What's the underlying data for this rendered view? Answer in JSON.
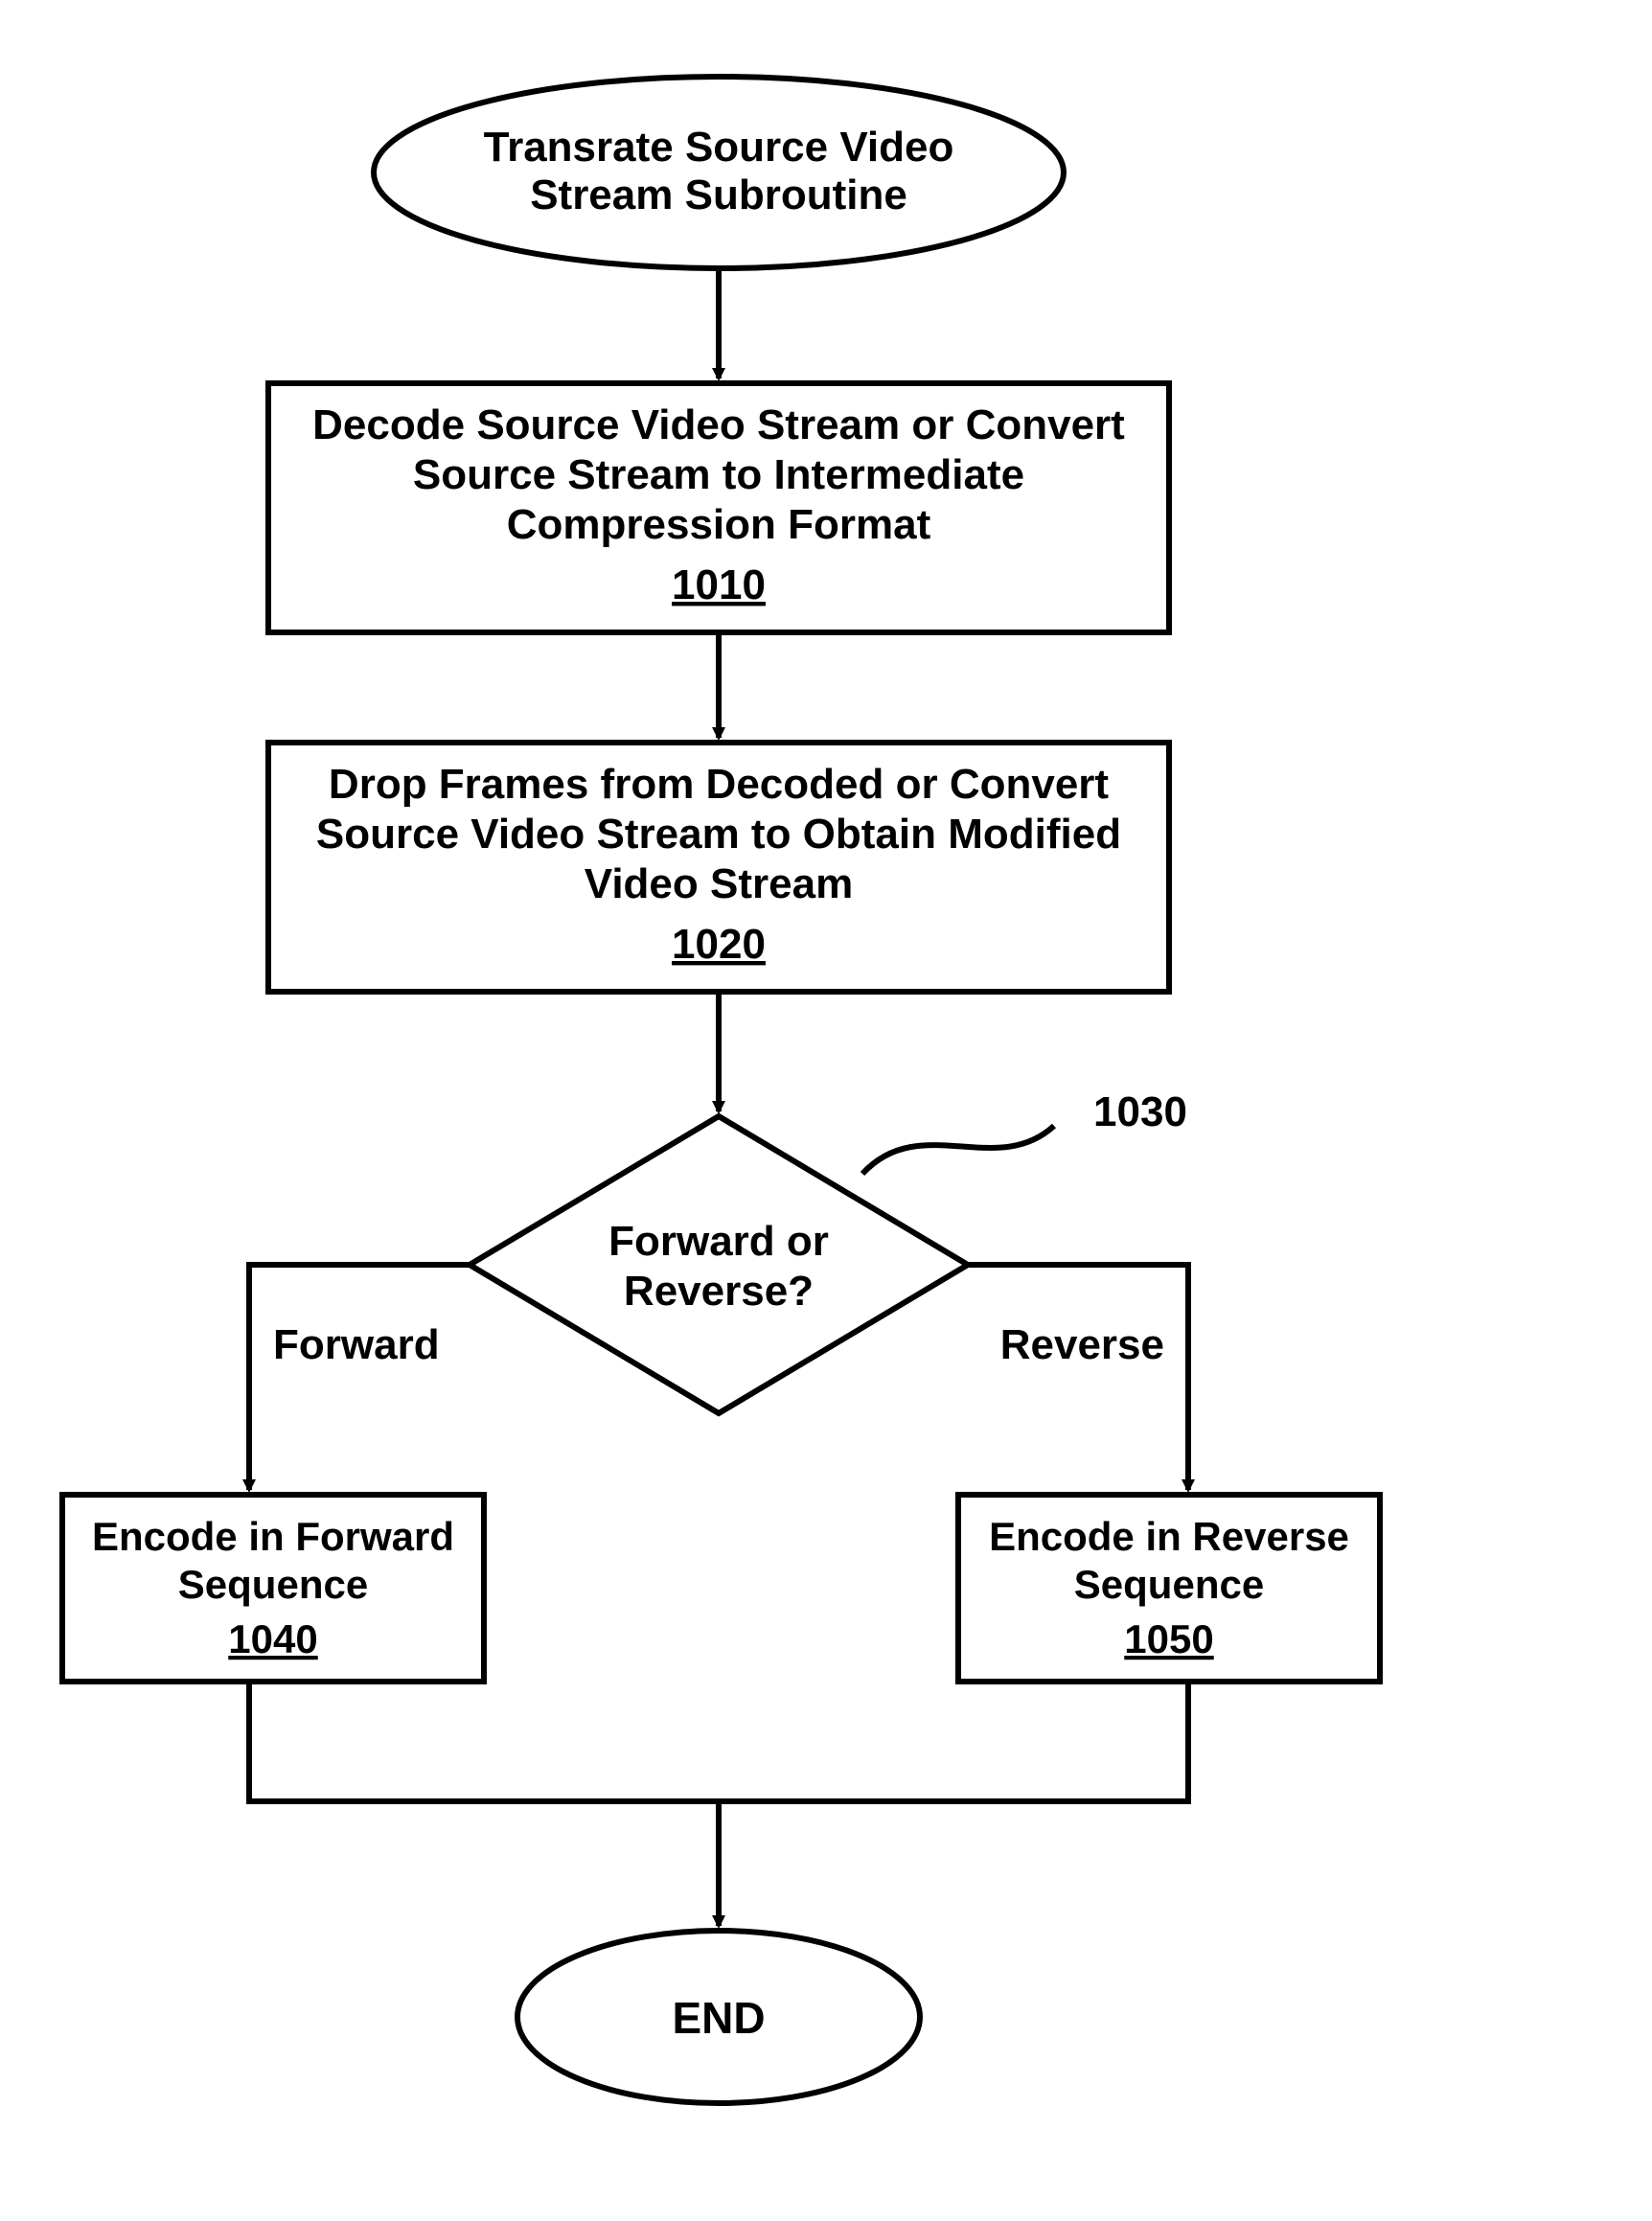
{
  "chart_data": {
    "type": "flowchart",
    "nodes": [
      {
        "id": "start",
        "shape": "terminator",
        "text_lines": [
          "Transrate Source  Video",
          "Stream Subroutine"
        ]
      },
      {
        "id": "n1010",
        "shape": "process",
        "ref": "1010",
        "text_lines": [
          "Decode Source Video Stream or Convert",
          "Source Stream to Intermediate",
          "Compression Format"
        ]
      },
      {
        "id": "n1020",
        "shape": "process",
        "ref": "1020",
        "text_lines": [
          "Drop Frames from Decoded or Convert",
          "Source Video Stream to Obtain Modified",
          "Video Stream"
        ]
      },
      {
        "id": "n1030",
        "shape": "decision",
        "ref": "1030",
        "text_lines": [
          "Forward or",
          "Reverse?"
        ]
      },
      {
        "id": "n1040",
        "shape": "process",
        "ref": "1040",
        "text_lines": [
          "Encode in Forward",
          "Sequence"
        ]
      },
      {
        "id": "n1050",
        "shape": "process",
        "ref": "1050",
        "text_lines": [
          "Encode in Reverse",
          "Sequence"
        ]
      },
      {
        "id": "end",
        "shape": "terminator",
        "text_lines": [
          "END"
        ]
      }
    ],
    "edges": [
      {
        "from": "start",
        "to": "n1010"
      },
      {
        "from": "n1010",
        "to": "n1020"
      },
      {
        "from": "n1020",
        "to": "n1030"
      },
      {
        "from": "n1030",
        "to": "n1040",
        "label": "Forward"
      },
      {
        "from": "n1030",
        "to": "n1050",
        "label": "Reverse"
      },
      {
        "from": "n1040",
        "to": "end"
      },
      {
        "from": "n1050",
        "to": "end"
      }
    ]
  },
  "start": {
    "line1": "Transrate Source  Video",
    "line2": "Stream Subroutine"
  },
  "n1010": {
    "line1": "Decode Source Video Stream or Convert",
    "line2": "Source Stream to Intermediate",
    "line3": "Compression Format",
    "ref": "1010"
  },
  "n1020": {
    "line1": "Drop Frames from Decoded or Convert",
    "line2": "Source Video Stream to Obtain Modified",
    "line3": "Video Stream",
    "ref": "1020"
  },
  "n1030": {
    "line1": "Forward or",
    "line2": "Reverse?",
    "ref": "1030"
  },
  "n1040": {
    "line1": "Encode in Forward",
    "line2": "Sequence",
    "ref": "1040"
  },
  "n1050": {
    "line1": "Encode in Reverse",
    "line2": "Sequence",
    "ref": "1050"
  },
  "end": {
    "line1": "END"
  },
  "labels": {
    "forward": "Forward",
    "reverse": "Reverse"
  }
}
